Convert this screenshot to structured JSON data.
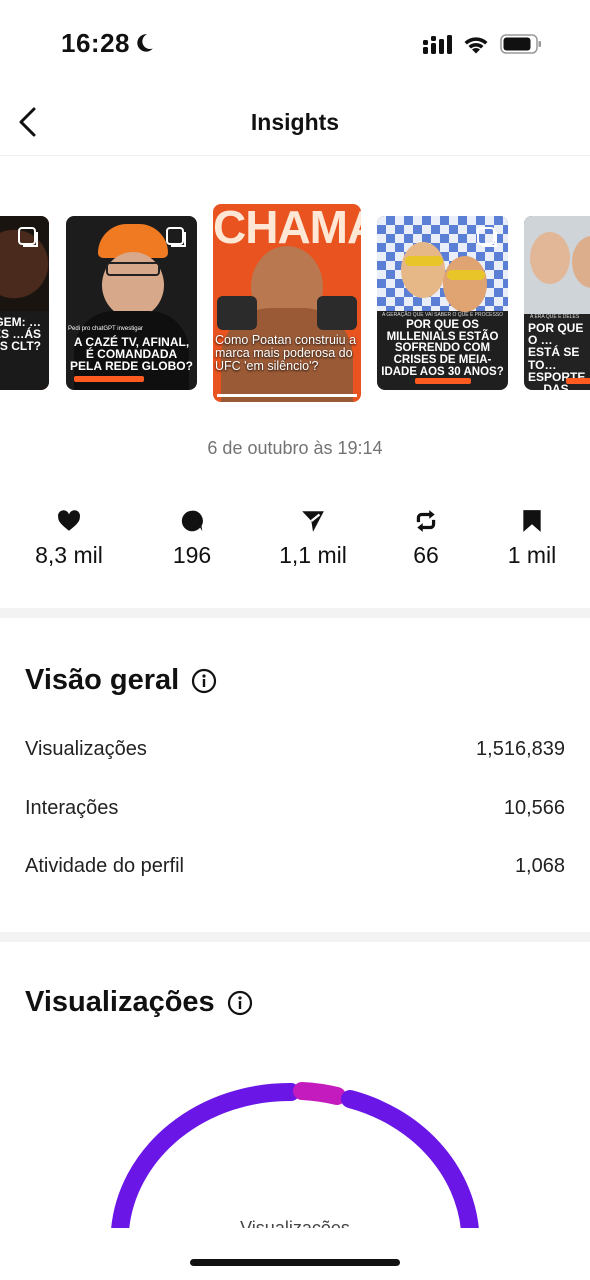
{
  "status_bar": {
    "time": "16:28",
    "icons": [
      "moon-icon",
      "signal-icon",
      "wifi-icon",
      "battery-icon"
    ]
  },
  "header": {
    "title": "Insights",
    "back_icon": "chevron-left-icon"
  },
  "carousel": {
    "posts": [
      {
        "id": "post-1",
        "headline": "…eragem: …ladores …ás redes CLT?",
        "bg": "#e8531f"
      },
      {
        "id": "post-2",
        "kicker": "Pedi pro chatGPT investigar",
        "headline": "A Cazé TV, afinal, é comandada pela Rede Globo?",
        "bg": "#1c1c1c"
      },
      {
        "id": "post-3",
        "banner": "CHAMA",
        "headline": "Como Poatan construiu a marca mais poderosa do UFC 'em silêncio'?",
        "bg": "#e8531f",
        "selected": true
      },
      {
        "id": "post-4",
        "kicker": "A GERAÇÃO QUE VAI SABER O QUE É PROCESSO",
        "headline": "Por que os millenials estão sofrendo com crises de meia-idade aos 30 anos?",
        "bg": "#1f1f1f"
      },
      {
        "id": "post-5",
        "kicker": "A ERA QUE É DELES",
        "headline": "Por que o … está se to… esporte … das celeb…",
        "bg": "#222222"
      }
    ]
  },
  "date": "6 de outubro às 19:14",
  "stats": [
    {
      "icon": "heart-icon",
      "value": "8,3 mil"
    },
    {
      "icon": "comment-icon",
      "value": "196"
    },
    {
      "icon": "share-icon",
      "value": "1,1 mil"
    },
    {
      "icon": "repost-icon",
      "value": "66"
    },
    {
      "icon": "bookmark-icon",
      "value": "1 mil"
    }
  ],
  "overview": {
    "title": "Visão geral",
    "rows": [
      {
        "label": "Visualizações",
        "value": "1,516,839"
      },
      {
        "label": "Interações",
        "value": "10,566"
      },
      {
        "label": "Atividade do perfil",
        "value": "1,068"
      }
    ]
  },
  "views_section": {
    "title": "Visualizações",
    "gauge_label": "Visualizações",
    "colors": {
      "primary": "#6a16e6",
      "secondary": "#c41bbf"
    }
  }
}
